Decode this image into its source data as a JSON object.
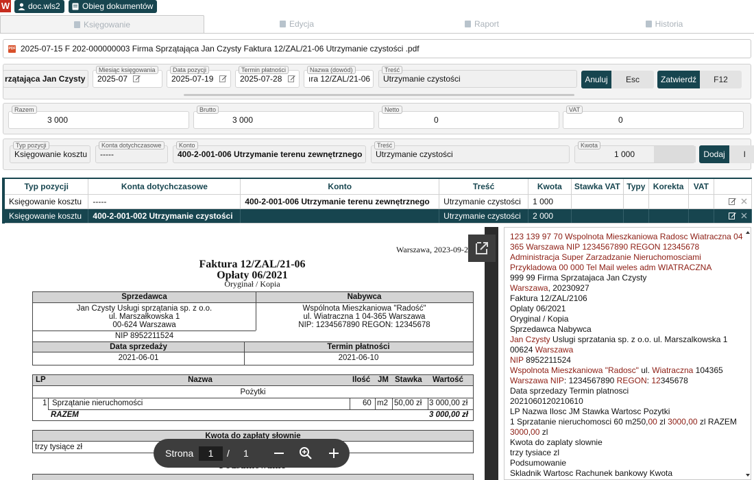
{
  "header": {
    "logo_letter": "W",
    "chip_user": "doc.wls2",
    "chip_module": "Obieg dokumentów"
  },
  "tabs": [
    {
      "label": "Księgowanie",
      "active": true
    },
    {
      "label": "Edycja",
      "active": false
    },
    {
      "label": "Raport",
      "active": false
    },
    {
      "label": "Historia",
      "active": false
    }
  ],
  "file": {
    "icon_label": "PDF",
    "name": "2025-07-15 F 202-000000003 Firma Sprzątająca Jan Czysty Faktura 12/ZAL/21-06 Utrzymanie czystości .pdf"
  },
  "doc_fields": {
    "contractor": "rzątająca Jan Czysty",
    "month_label": "Miesiąc księgowania",
    "month_value": "2025-07",
    "date_label": "Data pozycji",
    "date_value": "2025-07-19",
    "term_label": "Termin płatności",
    "term_value": "2025-07-28",
    "name_label": "Nazwa (dowód)",
    "name_value": "ıra 12/ZAL/21-06",
    "content_label": "Treść",
    "content_value": "Utrzymanie czystości",
    "cancel_label": "Anuluj",
    "cancel_key": "Esc",
    "confirm_label": "Zatwierdź",
    "confirm_key": "F12"
  },
  "summary": {
    "razem_label": "Razem",
    "razem_value": "3 000",
    "brutto_label": "Brutto",
    "brutto_value": "3 000",
    "netto_label": "Netto",
    "netto_value": "0",
    "vat_label": "VAT",
    "vat_value": "0"
  },
  "entry": {
    "type_label": "Typ pozycji",
    "type_value": "Księgowanie kosztu",
    "acc_label": "Konta dotychczasowe",
    "acc_value": "-----",
    "konto_label": "Konto",
    "konto_value": "400-2-001-006 Utrzymanie terenu zewnętrznego",
    "tresc_label": "Treść",
    "tresc_value": "Utrzymanie czystości",
    "kwota_label": "Kwota",
    "kwota_value": "1 000",
    "add_label": "Dodaj",
    "add_key": "I"
  },
  "table": {
    "columns": [
      "Typ pozycji",
      "Konta dotychczasowe",
      "Konto",
      "Treść",
      "Kwota",
      "Stawka VAT",
      "Typy",
      "Korekta",
      "VAT",
      ""
    ],
    "rows": [
      {
        "type": "Księgowanie kosztu",
        "prev": "-----",
        "konto": "400-2-001-006 Utrzymanie terenu zewnętrznego",
        "tresc": "Utrzymanie czystości",
        "kwota": "1 000",
        "selected": false
      },
      {
        "type": "Księgowanie kosztu",
        "prev": "400-2-001-002 Utrzymanie czystości",
        "konto": "",
        "tresc": "Utrzymanie czystości",
        "kwota": "2 000",
        "selected": true
      }
    ]
  },
  "pdf": {
    "place_date": "Warszawa, 2023-09-27",
    "title": "Faktura 12/ZAL/21-06",
    "subtitle": "Opłaty 06/2021",
    "orig": "Oryginał / Kopia",
    "seller_h": "Sprzedawca",
    "buyer_h": "Nabywca",
    "seller_l1": "Jan Czysty Usługi sprzątania sp. z o.o.",
    "seller_l2": "ul. Marszałkowska 1",
    "seller_l3": "00-624 Warszawa",
    "buyer_l1": "Wspólnota Mieszkaniowa \"Radość\"",
    "buyer_l2": "ul. Wiatraczna 1 04-365 Warszawa",
    "buyer_l3": "NIP: 1234567890 REGON: 12345678",
    "seller_nip": "NIP 8952211524",
    "sale_date_h": "Data sprzedaży",
    "pay_term_h": "Termin płatności",
    "sale_date": "2021-06-01",
    "pay_term": "2021-06-10",
    "items_cols": [
      "LP",
      "Nazwa",
      "Ilość",
      "JM",
      "Stawka",
      "Wartość"
    ],
    "group": "Pożytki",
    "item": {
      "lp": "1",
      "name": "Sprzątanie nieruchomości",
      "qty": "60",
      "jm": "m2",
      "rate": "50,00 zł",
      "value": "3 000,00 zł"
    },
    "razem_label": "RAZEM",
    "razem_value": "3 000,00 zł",
    "words_h": "Kwota do zapłaty słownie",
    "words": "trzy tysiące zł",
    "summary_h": "Podsumowanie"
  },
  "pager": {
    "label": "Strona",
    "page": "1",
    "sep": "/",
    "total": "1"
  },
  "ocr_lines": [
    [
      {
        "t": "123 139 97 70 Wspolnota Mieszkaniowa Radosc Wiatraczna 04 365 Warszawa NIP 1234567890 REGON 12345678",
        "c": "r"
      }
    ],
    [
      {
        "t": "Administracja Super Zarzadzanie Nieruchomosciami Przykladowa 00 000 Tel Mail weles adm WIATRACZNA",
        "c": "r"
      }
    ],
    [
      {
        "t": "999 99 Firma Sprzatajaca Jan Czysty",
        "c": "k"
      }
    ],
    [
      {
        "t": "Warszawa",
        "c": "r"
      },
      {
        "t": ", 20230927",
        "c": "k"
      }
    ],
    [
      {
        "t": "Faktura 12/ZAL/2106",
        "c": "k"
      }
    ],
    [
      {
        "t": "Oplaty 06/2021",
        "c": "k"
      }
    ],
    [
      {
        "t": "Orygina",
        "c": "k"
      },
      {
        "t": "l",
        "c": "k"
      },
      {
        "t": " / Kopia",
        "c": "k"
      }
    ],
    [
      {
        "t": "Sprzedawca Nabywca",
        "c": "k"
      }
    ],
    [
      {
        "t": "Jan Czysty",
        "c": "r"
      },
      {
        "t": " Uslugi sprzatania sp. z o.o. ul. Marszalkowska 1 00624 ",
        "c": "k"
      },
      {
        "t": "Warszawa",
        "c": "r"
      }
    ],
    [
      {
        "t": "NIP",
        "c": "r"
      },
      {
        "t": " 8952211524",
        "c": "k"
      }
    ],
    [
      {
        "t": "Wspolnota Mieszkaniowa \"Radosc\"",
        "c": "r"
      },
      {
        "t": " ul. ",
        "c": "k"
      },
      {
        "t": "Wiatraczna",
        "c": "r"
      },
      {
        "t": " 104365 ",
        "c": "k"
      },
      {
        "t": "Warszawa NIP",
        "c": "r"
      },
      {
        "t": ": 1234567890 ",
        "c": "k"
      },
      {
        "t": "REGON",
        "c": "r"
      },
      {
        "t": ": ",
        "c": "k"
      },
      {
        "t": "12",
        "c": "r"
      },
      {
        "t": "345678",
        "c": "k"
      }
    ],
    [
      {
        "t": "Data sprzedazy Termin platnosci",
        "c": "k"
      }
    ],
    [
      {
        "t": "2021060120210610",
        "c": "k"
      }
    ],
    [
      {
        "t": "LP Nazwa Ilosc JM Stawka Wartosc Pozytki",
        "c": "k"
      }
    ],
    [
      {
        "t": "1 Sprzatanie nieruchomosci 60 m250,",
        "c": "k"
      },
      {
        "t": "00",
        "c": "r"
      },
      {
        "t": " zl ",
        "c": "k"
      },
      {
        "t": "3000",
        "c": "r"
      },
      {
        "t": ",",
        "c": "k"
      },
      {
        "t": "00",
        "c": "r"
      },
      {
        "t": " zl RAZEM ",
        "c": "k"
      },
      {
        "t": "3000",
        "c": "r"
      },
      {
        "t": ",",
        "c": "k"
      },
      {
        "t": "00",
        "c": "r"
      },
      {
        "t": " zl",
        "c": "k"
      }
    ],
    [
      {
        "t": "Kwota do zaplaty slownie",
        "c": "k"
      }
    ],
    [
      {
        "t": "trzy tysiace zl",
        "c": "k"
      }
    ],
    [
      {
        "t": "Podsumowanie",
        "c": "k"
      }
    ],
    [
      {
        "t": "Skladnik Wartosc Rachunek bankowy Kwota",
        "c": "k"
      }
    ]
  ]
}
